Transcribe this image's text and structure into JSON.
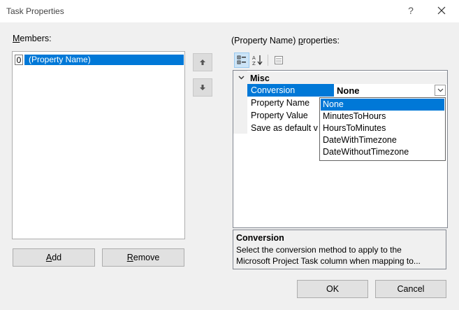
{
  "window": {
    "title": "Task Properties",
    "help_label": "?"
  },
  "members": {
    "label_underlined": "M",
    "label_rest": "embers:",
    "items": [
      {
        "index": "0",
        "name": "(Property Name)"
      }
    ]
  },
  "buttons": {
    "add_underlined": "A",
    "add_rest": "dd",
    "remove_underlined": "R",
    "remove_rest": "emove",
    "ok": "OK",
    "cancel": "Cancel"
  },
  "properties": {
    "label_pre": "(Property Name) ",
    "label_underlined": "p",
    "label_post": "roperties:",
    "category": "Misc",
    "rows": [
      {
        "name": "Conversion",
        "value": "None"
      },
      {
        "name": "Property Name",
        "value": ""
      },
      {
        "name": "Property Value",
        "value": ""
      },
      {
        "name": "Save as default v",
        "value": ""
      }
    ]
  },
  "dropdown": {
    "options": [
      "None",
      "MinutesToHours",
      "HoursToMinutes",
      "DateWithTimezone",
      "DateWithoutTimezone"
    ],
    "selected": "None"
  },
  "description": {
    "title": "Conversion",
    "line1": "Select the conversion method to apply to the",
    "line2": "Microsoft Project Task column when mapping to..."
  },
  "colors": {
    "selection": "#0078d7",
    "window_bg": "#f0f0f0"
  }
}
